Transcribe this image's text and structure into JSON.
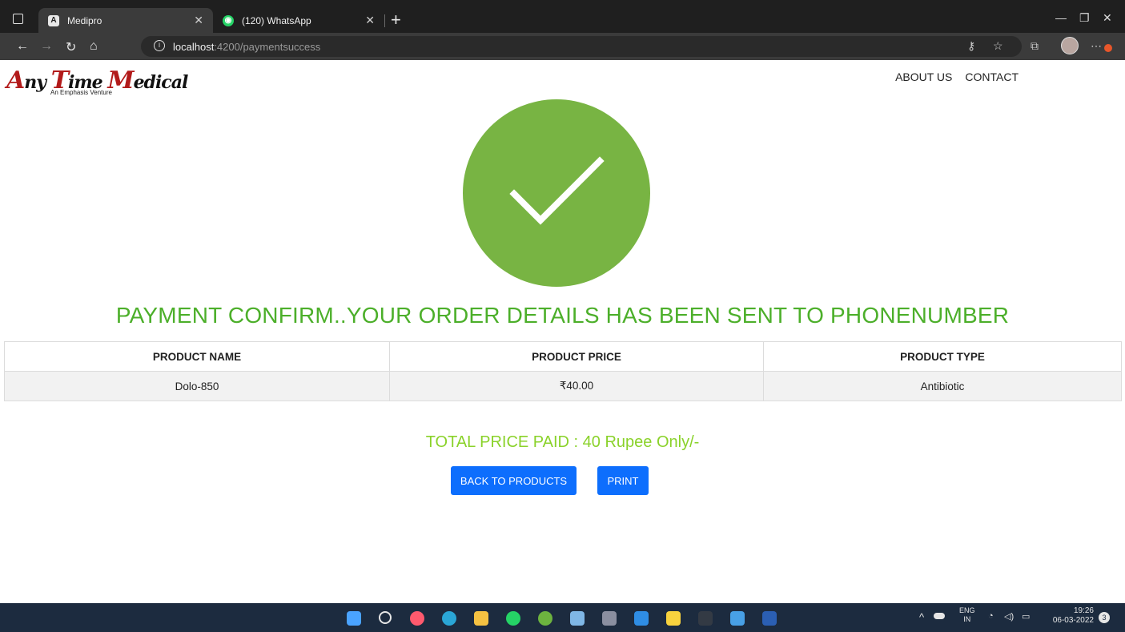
{
  "browser": {
    "tabs": [
      {
        "title": "Medipro",
        "favicon": "A",
        "active": true
      },
      {
        "title": "(120) WhatsApp",
        "favicon": "◉",
        "active": false
      }
    ],
    "url_host": "localhost",
    "url_rest": ":4200/paymentsuccess"
  },
  "site": {
    "logo_text": "Any Time Medical",
    "logo_tagline": "An Emphasis Venture",
    "nav": [
      "ABOUT US",
      "CONTACT"
    ]
  },
  "confirmation": {
    "headline": "PAYMENT CONFIRM..YOUR ORDER DETAILS HAS BEEN SENT TO PHONENUMBER",
    "check_color": "#78b443",
    "headline_color": "#4caf2a"
  },
  "order_table": {
    "headers": [
      "PRODUCT NAME",
      "PRODUCT PRICE",
      "PRODUCT TYPE"
    ],
    "rows": [
      [
        "Dolo-850",
        "₹40.00",
        "Antibiotic"
      ]
    ]
  },
  "total_text": "TOTAL PRICE PAID : 40 Rupee Only/-",
  "buttons": {
    "back": "BACK TO PRODUCTS",
    "print": "PRINT",
    "color": "#0d6efd"
  },
  "taskbar": {
    "lang_top": "ENG",
    "lang_bottom": "IN",
    "time": "19:26",
    "date": "06-03-2022",
    "notifications": "3"
  }
}
